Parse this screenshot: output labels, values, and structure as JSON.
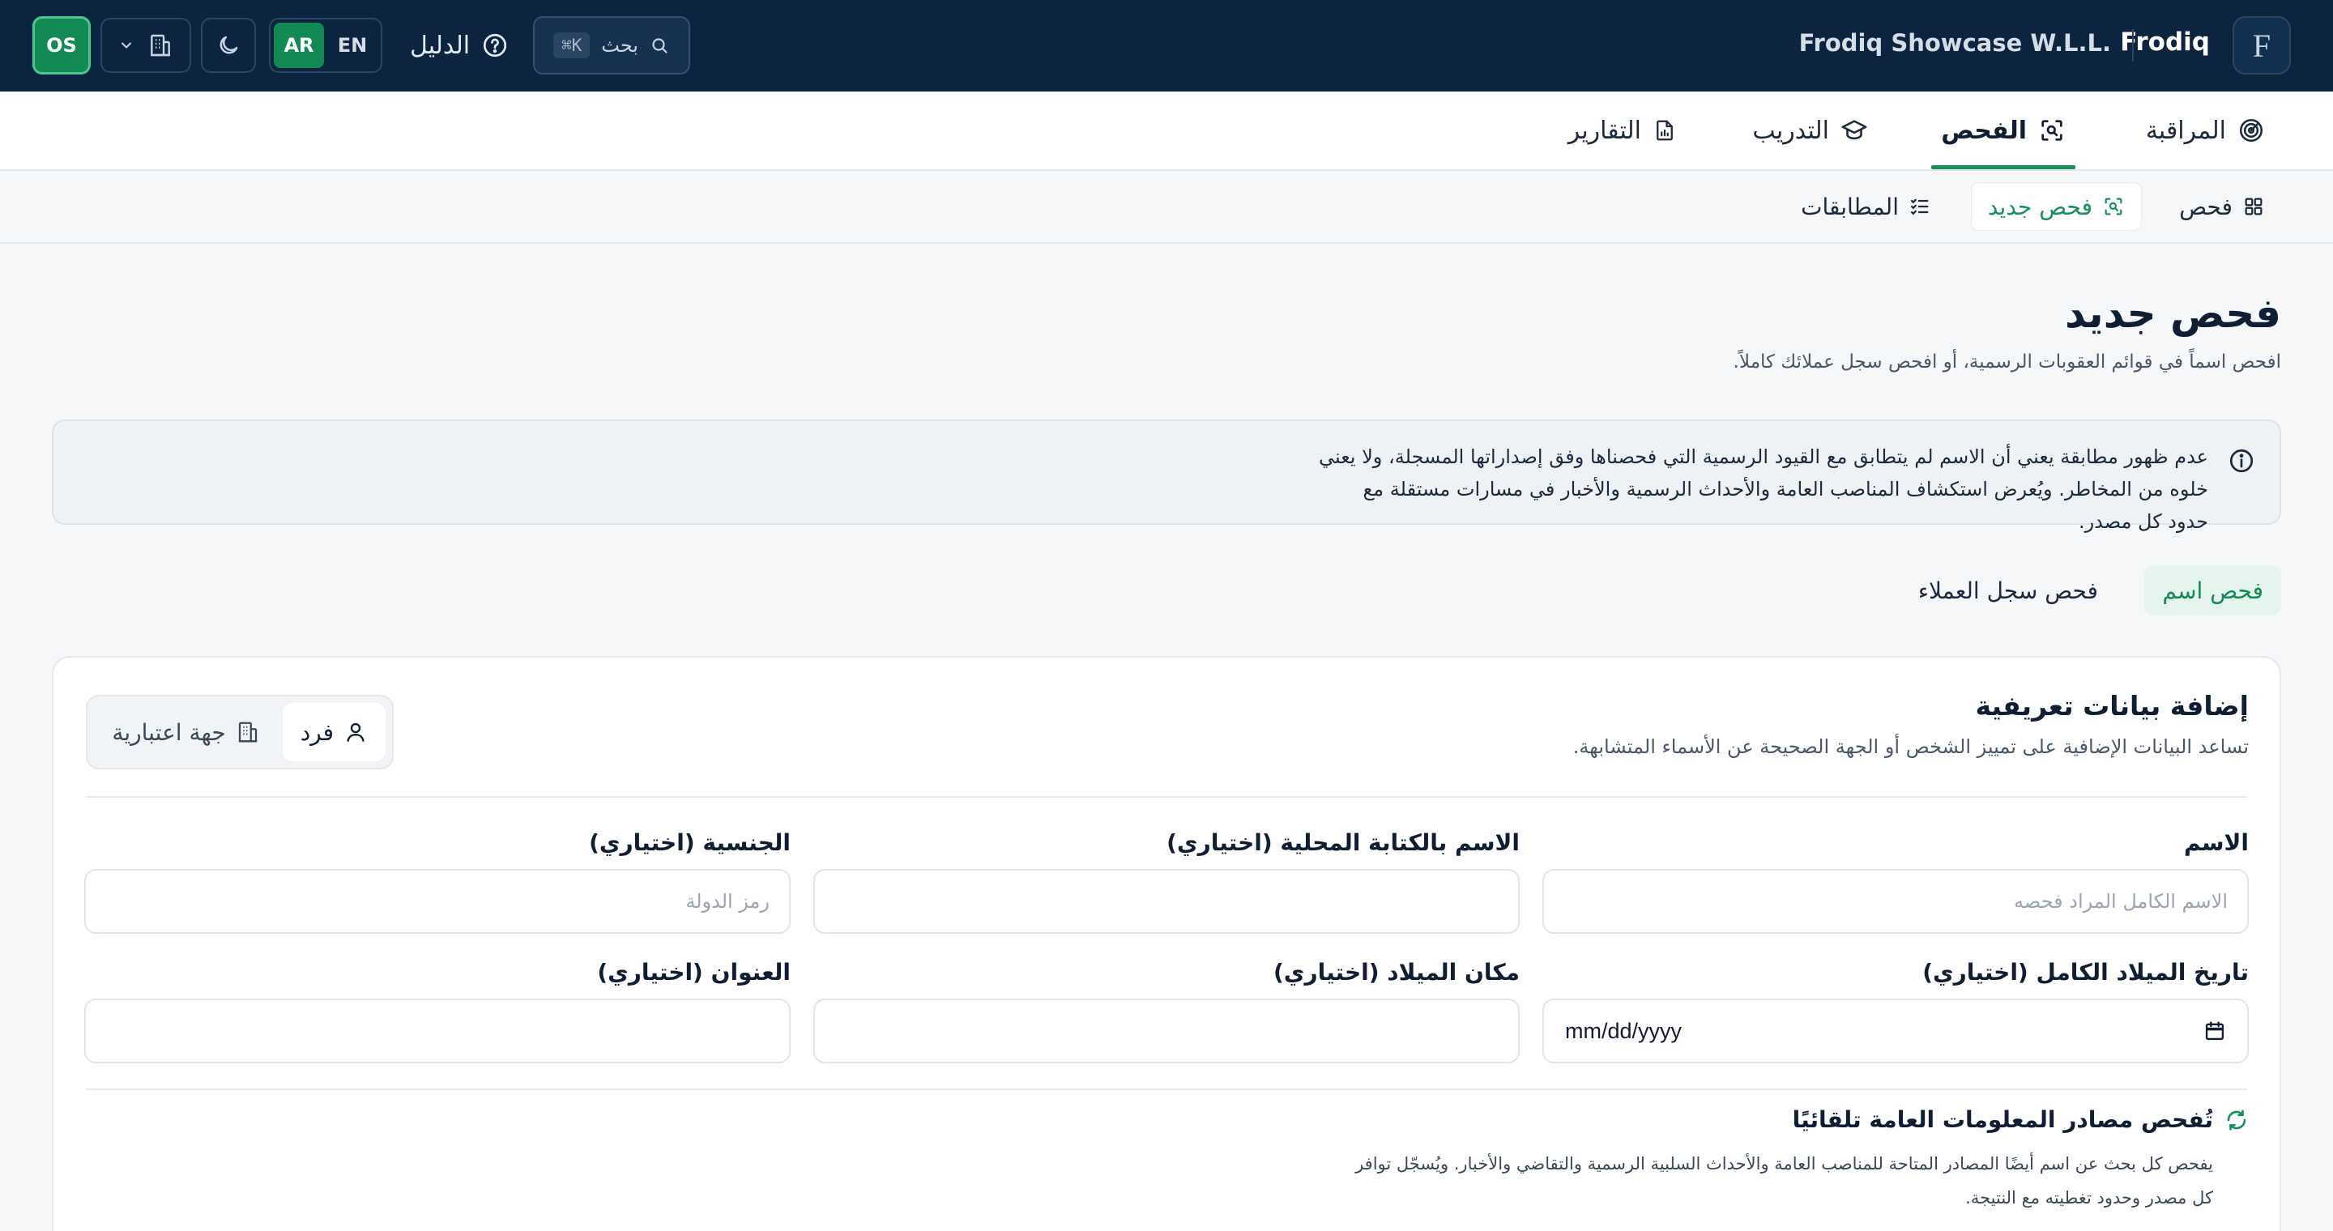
{
  "topbar": {
    "brand_initial": "F",
    "brand_name": "Frodiq",
    "company_name": "Frodiq Showcase W.L.L.",
    "search_label": "بحث",
    "search_shortcut": "⌘K",
    "help_label": "الدليل",
    "lang_ar": "AR",
    "lang_en": "EN",
    "active_lang": "AR",
    "user_initials": "OS"
  },
  "primary_nav": {
    "items": [
      {
        "label": "المراقبة",
        "icon": "radar-icon"
      },
      {
        "label": "الفحص",
        "icon": "scan-icon",
        "active": true
      },
      {
        "label": "التدريب",
        "icon": "graduation-cap-icon"
      },
      {
        "label": "التقارير",
        "icon": "report-file-icon"
      }
    ]
  },
  "secondary_nav": {
    "items": [
      {
        "label": "فحص",
        "icon": "grid-icon"
      },
      {
        "label": "فحص جديد",
        "icon": "scan-icon",
        "active": true
      },
      {
        "label": "المطابقات",
        "icon": "list-check-icon"
      }
    ]
  },
  "page": {
    "title": "فحص جديد",
    "subtitle": "افحص اسماً في قوائم العقوبات الرسمية، أو افحص سجل عملائك كاملاً."
  },
  "notice": {
    "text": "عدم ظهور مطابقة يعني أن الاسم لم يتطابق مع القيود الرسمية التي فحصناها وفق إصداراتها المسجلة، ولا يعني خلوه من المخاطر. ويُعرض استكشاف المناصب العامة والأحداث الرسمية والأخبار في مسارات مستقلة مع حدود كل مصدر."
  },
  "mode_tabs": [
    {
      "label": "فحص اسم",
      "active": true
    },
    {
      "label": "فحص سجل العملاء",
      "active": false
    }
  ],
  "card": {
    "title": "إضافة بيانات تعريفية",
    "subtitle": "تساعد البيانات الإضافية على تمييز الشخص أو الجهة الصحيحة عن الأسماء المتشابهة.",
    "entity_types": [
      {
        "label": "فرد",
        "icon": "user-icon",
        "active": true
      },
      {
        "label": "جهة اعتبارية",
        "icon": "building-icon",
        "active": false
      }
    ],
    "fields": {
      "name_label": "الاسم",
      "name_placeholder": "الاسم الكامل المراد فحصه",
      "name_value": "",
      "local_name_label": "الاسم بالكتابة المحلية (اختياري)",
      "local_name_value": "",
      "nationality_label": "الجنسية (اختياري)",
      "nationality_placeholder": "رمز الدولة",
      "nationality_value": "",
      "dob_label": "تاريخ الميلاد الكامل (اختياري)",
      "dob_placeholder": "mm/dd/yyyy",
      "birthplace_label": "مكان الميلاد (اختياري)",
      "birthplace_value": "",
      "address_label": "العنوان (اختياري)",
      "address_value": ""
    },
    "auto_check": {
      "title": "تُفحص مصادر المعلومات العامة تلقائيًا",
      "text": "يفحص كل بحث عن اسم أيضًا المصادر المتاحة للمناصب العامة والأحداث السلبية الرسمية والتقاضي والأخبار. ويُسجّل توافر كل مصدر وحدود تغطيته مع النتيجة."
    }
  },
  "colors": {
    "topbar_bg": "#0c2440",
    "accent_green": "#128a53",
    "page_bg": "#f5f7f8"
  }
}
